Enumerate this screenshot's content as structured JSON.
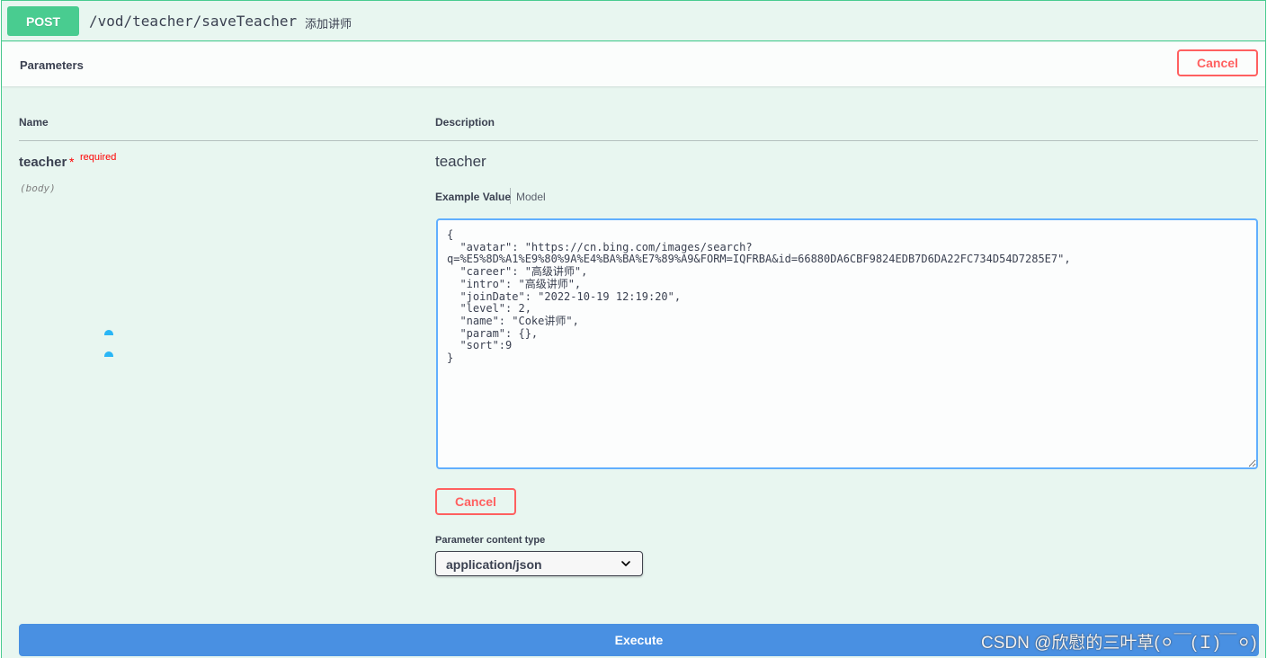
{
  "operation": {
    "method": "POST",
    "path": "/vod/teacher/saveTeacher",
    "summary": "添加讲师"
  },
  "parameters_section": {
    "title": "Parameters",
    "cancel_label": "Cancel"
  },
  "table": {
    "name_header": "Name",
    "description_header": "Description"
  },
  "parameter": {
    "name": "teacher",
    "required_mark": "*",
    "required_label": "required",
    "location": "(body)",
    "description": "teacher"
  },
  "example_tabs": {
    "active": "Example Value",
    "inactive": "Model"
  },
  "request_body": "{\n  \"avatar\": \"https://cn.bing.com/images/search?q=%E5%8D%A1%E9%80%9A%E4%BA%BA%E7%89%A9&FORM=IQFRBA&id=66880DA6CBF9824EDB7D6DA22FC734D54D7285E7\",\n  \"career\": \"高级讲师\",\n  \"intro\": \"高级讲师\",\n  \"joinDate\": \"2022-10-19 12:19:20\",\n  \"level\": 2,\n  \"name\": \"Coke讲师\",\n  \"param\": {},\n  \"sort\":9\n}",
  "body_cancel_label": "Cancel",
  "content_type": {
    "label": "Parameter content type",
    "value": "application/json"
  },
  "execute_label": "Execute",
  "watermark": "CSDN @欣慰的三叶草(⚪￣(Ｉ)￣⚪)",
  "colors": {
    "post_green": "#49cc90",
    "block_bg": "#e8f6f0",
    "cancel_red": "#ff6060",
    "execute_blue": "#4990e2",
    "editor_border": "#61affe"
  },
  "icons": {
    "select_arrow": "chevron-down-icon"
  }
}
